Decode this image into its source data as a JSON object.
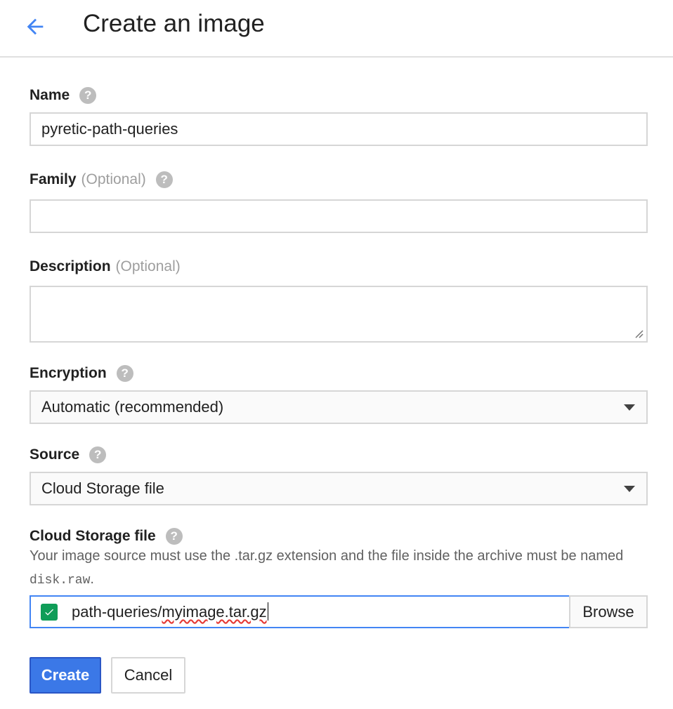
{
  "header": {
    "title": "Create an image",
    "back_icon": "arrow-back-icon"
  },
  "form": {
    "name": {
      "label": "Name",
      "value": "pyretic-path-queries",
      "help": "?"
    },
    "family": {
      "label": "Family",
      "optional": "(Optional)",
      "value": "",
      "help": "?"
    },
    "description": {
      "label": "Description",
      "optional": "(Optional)",
      "value": ""
    },
    "encryption": {
      "label": "Encryption",
      "selected": "Automatic (recommended)",
      "help": "?"
    },
    "source": {
      "label": "Source",
      "selected": "Cloud Storage file",
      "help": "?"
    },
    "cloud_storage_file": {
      "label": "Cloud Storage file",
      "help": "?",
      "helper_text_before": "Your image source must use the .tar.gz extension and the file inside the archive must be named ",
      "helper_code": "disk.raw",
      "helper_text_after": ".",
      "path_prefix": "path-queries/",
      "path_file": "myimage.tar.gz",
      "browse_label": "Browse"
    }
  },
  "actions": {
    "create_label": "Create",
    "cancel_label": "Cancel"
  },
  "colors": {
    "primary": "#3b78e7",
    "focus_border": "#4285f4",
    "valid_check": "#0f9d58",
    "back_arrow": "#4285f4"
  }
}
